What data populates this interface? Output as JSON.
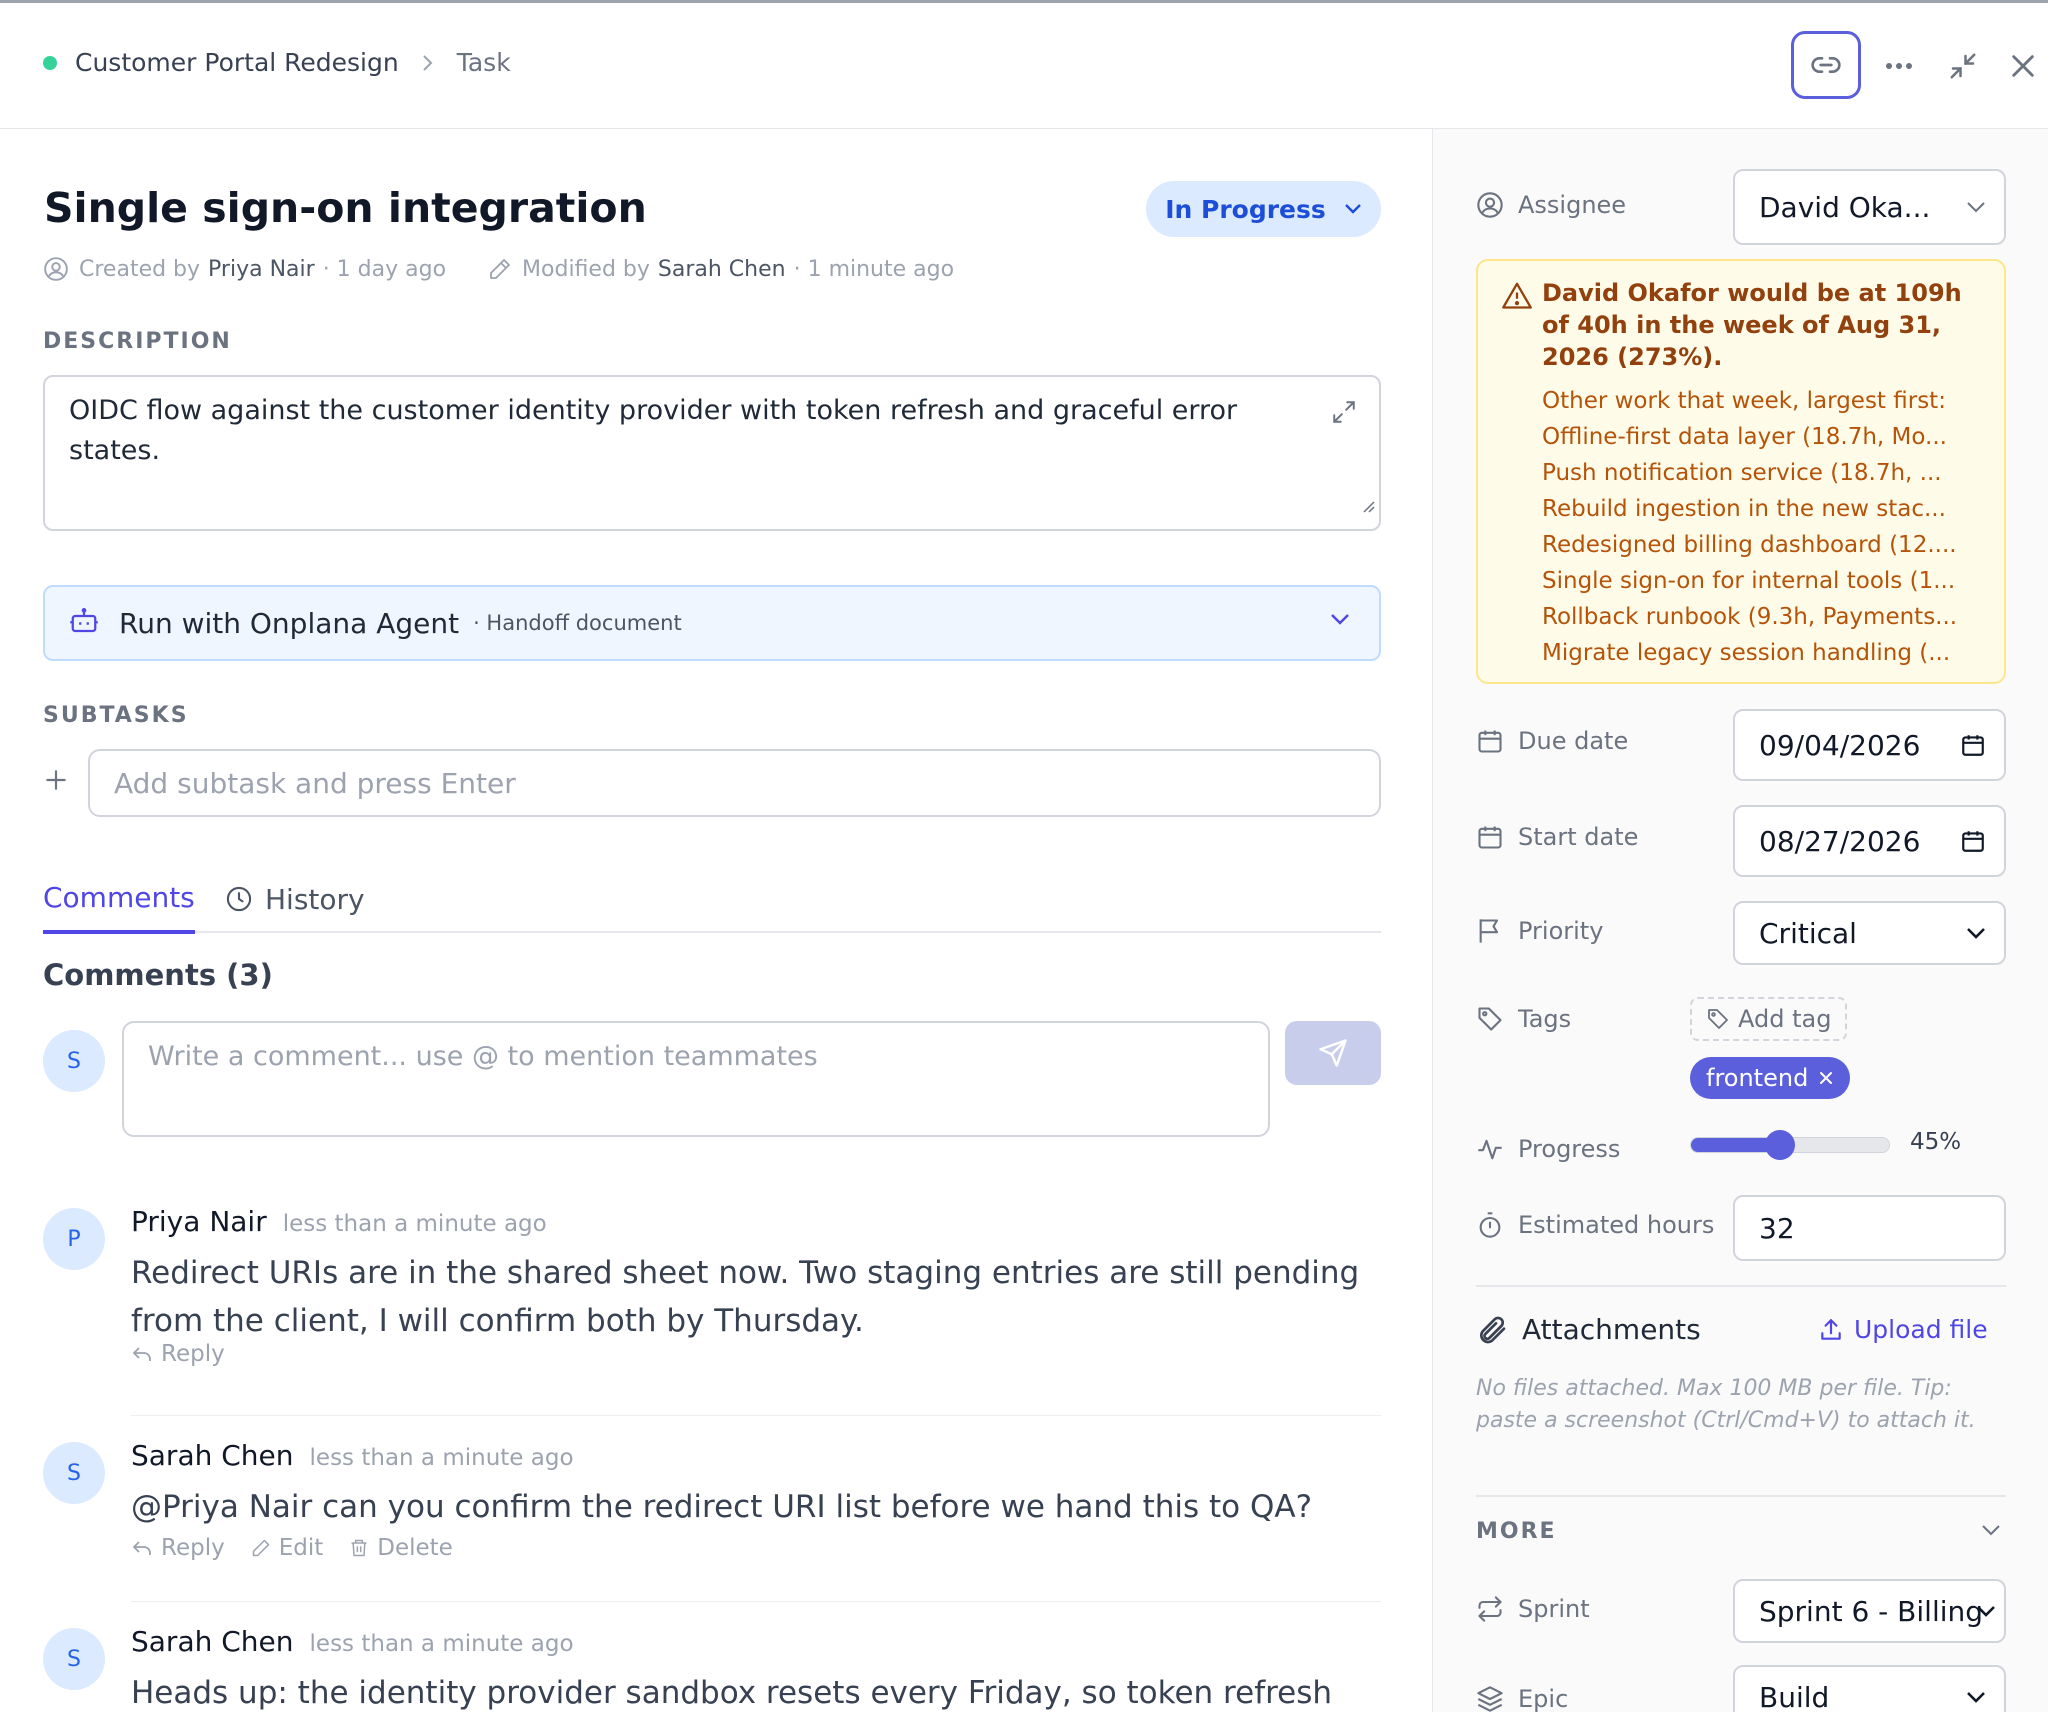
{
  "header": {
    "breadcrumb_project": "Customer Portal Redesign",
    "breadcrumb_item": "Task",
    "status_dot_color": "#34d399"
  },
  "task": {
    "title": "Single sign-on integration",
    "status": "In Progress",
    "created_by_label": "Created by",
    "created_by": "Priya Nair",
    "created_ago": "· 1 day ago",
    "modified_by_label": "Modified by",
    "modified_by": "Sarah Chen",
    "modified_ago": "· 1 minute ago"
  },
  "description": {
    "label": "DESCRIPTION",
    "text": "OIDC flow against the customer identity provider with token refresh and graceful error states."
  },
  "agent": {
    "label": "Run with Onplana Agent",
    "sub": "· Handoff document"
  },
  "subtasks": {
    "label": "SUBTASKS",
    "placeholder": "Add subtask and press Enter"
  },
  "tabs": {
    "comments": "Comments",
    "history": "History"
  },
  "comments": {
    "heading": "Comments (3)",
    "current_user_initial": "S",
    "input_placeholder": "Write a comment... use @ to mention teammates",
    "items": [
      {
        "initial": "P",
        "author": "Priya Nair",
        "time": "less than a minute ago",
        "body": "Redirect URIs are in the shared sheet now. Two staging entries are still pending from the client, I will confirm both by Thursday.",
        "reply": "Reply"
      },
      {
        "initial": "S",
        "author": "Sarah Chen",
        "time": "less than a minute ago",
        "body": "@Priya Nair can you confirm the redirect URI list before we hand this to QA?",
        "reply": "Reply",
        "edit": "Edit",
        "delete": "Delete"
      },
      {
        "initial": "S",
        "author": "Sarah Chen",
        "time": "less than a minute ago",
        "body": "Heads up: the identity provider sandbox resets every Friday, so token refresh"
      }
    ]
  },
  "sidebar": {
    "assignee_label": "Assignee",
    "assignee_value": "David Oka...",
    "warning": {
      "heading": "David Okafor would be at 109h of 40h in the week of Aug 31, 2026 (273%).",
      "intro": "Other work that week, largest first:",
      "items": [
        "Offline-first data layer (18.7h, Mo...",
        "Push notification service (18.7h, ...",
        "Rebuild ingestion in the new stac...",
        "Redesigned billing dashboard (12....",
        "Single sign-on for internal tools (1...",
        "Rollback runbook (9.3h, Payments...",
        "Migrate legacy session handling (..."
      ]
    },
    "due_date_label": "Due date",
    "due_date_value": "09/04/2026",
    "start_date_label": "Start date",
    "start_date_value": "08/27/2026",
    "priority_label": "Priority",
    "priority_value": "Critical",
    "tags_label": "Tags",
    "add_tag": "Add tag",
    "tag": "frontend",
    "progress_label": "Progress",
    "progress_value": 45,
    "progress_text": "45%",
    "estimated_label": "Estimated hours",
    "estimated_value": "32",
    "attachments_label": "Attachments",
    "upload_label": "Upload file",
    "attachments_note": "No files attached. Max 100 MB per file. Tip: paste a screenshot (Ctrl/Cmd+V) to attach it.",
    "more_label": "MORE",
    "sprint_label": "Sprint",
    "sprint_value": "Sprint 6 - Billing",
    "epic_label": "Epic",
    "epic_value": "Build"
  },
  "colors": {
    "accent": "#4f46e5",
    "status_bg": "#dbeafe",
    "status_text": "#1d4ed8",
    "warning_bg": "#fefce8",
    "warning_text": "#92400e"
  }
}
